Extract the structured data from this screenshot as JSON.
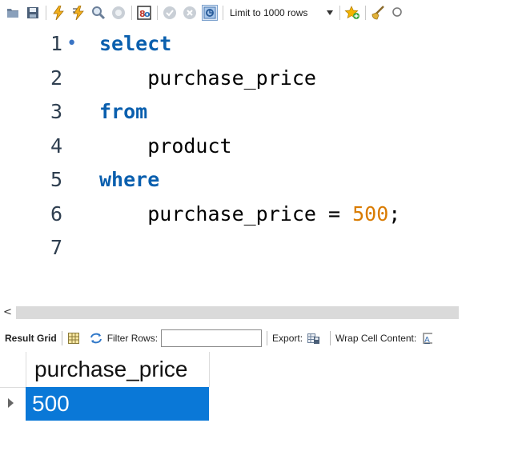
{
  "toolbar": {
    "buttons": [
      {
        "icon": "open-folder-icon"
      },
      {
        "icon": "save-icon"
      },
      {
        "icon": "execute-lightning-icon"
      },
      {
        "icon": "execute-current-lightning-icon"
      },
      {
        "icon": "explain-magnifier-icon"
      },
      {
        "icon": "stop-icon"
      },
      {
        "icon": "toggle-results-icon"
      },
      {
        "icon": "commit-check-icon"
      },
      {
        "icon": "rollback-icon"
      },
      {
        "icon": "autocommit-icon"
      }
    ],
    "limit_label": "Limit to 1000 rows"
  },
  "editor": {
    "lines": [
      {
        "num": "1",
        "marker": "•",
        "indent": "",
        "tokens": [
          {
            "t": "select",
            "k": "kw"
          }
        ]
      },
      {
        "num": "2",
        "marker": "",
        "indent": "    ",
        "tokens": [
          {
            "t": "purchase_price",
            "k": ""
          }
        ]
      },
      {
        "num": "3",
        "marker": "",
        "indent": "",
        "tokens": [
          {
            "t": "from",
            "k": "kw"
          }
        ]
      },
      {
        "num": "4",
        "marker": "",
        "indent": "    ",
        "tokens": [
          {
            "t": "product",
            "k": ""
          }
        ]
      },
      {
        "num": "5",
        "marker": "",
        "indent": "",
        "tokens": [
          {
            "t": "where",
            "k": "kw"
          }
        ]
      },
      {
        "num": "6",
        "marker": "",
        "indent": "    ",
        "tokens": [
          {
            "t": "purchase_price ",
            "k": ""
          },
          {
            "t": "=",
            "k": "op"
          },
          {
            "t": " ",
            "k": ""
          },
          {
            "t": "500",
            "k": "num"
          },
          {
            "t": ";",
            "k": ""
          }
        ]
      },
      {
        "num": "7",
        "marker": "",
        "indent": "",
        "tokens": []
      }
    ]
  },
  "result_toolbar": {
    "result_grid_label": "Result Grid",
    "filter_rows_label": "Filter Rows:",
    "filter_value": "",
    "export_label": "Export:",
    "wrap_label": "Wrap Cell Content:"
  },
  "grid": {
    "columns": [
      "purchase_price"
    ],
    "rows": [
      [
        "500"
      ]
    ]
  },
  "colors": {
    "keyword": "#0a5fae",
    "number": "#d97b00",
    "selected_cell": "#0a78d7"
  }
}
